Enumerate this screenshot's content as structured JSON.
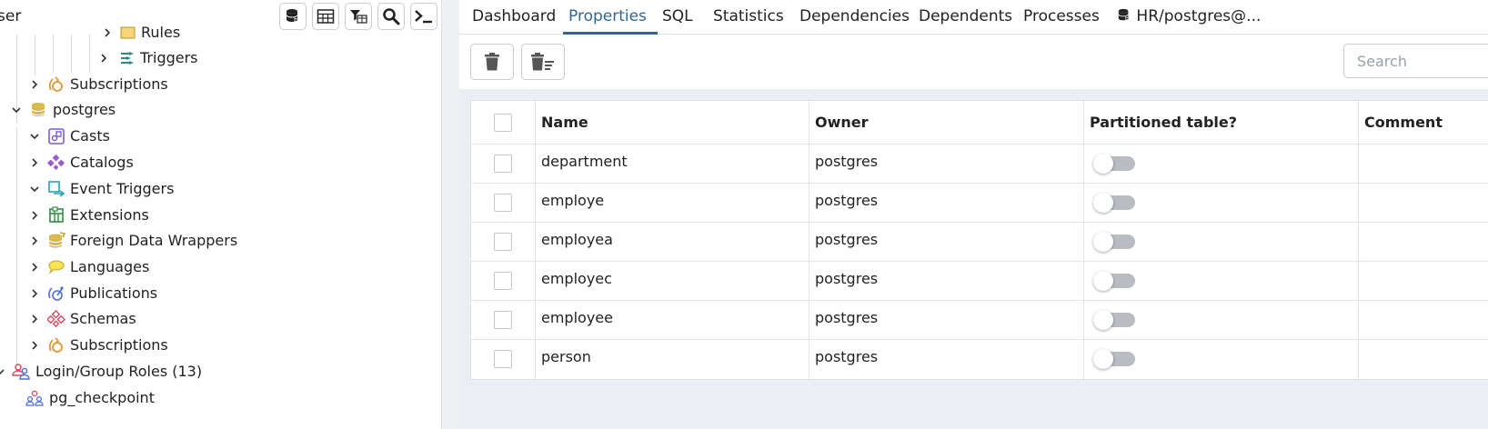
{
  "left_panel": {
    "title": "ser",
    "toolbar_icons": [
      "database-icon",
      "table-icon",
      "filter-icon",
      "search-icon",
      "terminal-icon"
    ],
    "tree": [
      {
        "label": "Rules",
        "chevron": "right",
        "icon": "rules-icon"
      },
      {
        "label": "Triggers",
        "chevron": "right",
        "icon": "triggers-icon"
      },
      {
        "label": "Subscriptions",
        "chevron": "right",
        "icon": "subscriptions-icon"
      },
      {
        "label": "postgres",
        "chevron": "down",
        "icon": "database-icon"
      },
      {
        "label": "Casts",
        "chevron": "down",
        "icon": "casts-icon"
      },
      {
        "label": "Catalogs",
        "chevron": "right",
        "icon": "catalogs-icon"
      },
      {
        "label": "Event Triggers",
        "chevron": "down",
        "icon": "event-triggers-icon"
      },
      {
        "label": "Extensions",
        "chevron": "right",
        "icon": "extensions-icon"
      },
      {
        "label": "Foreign Data Wrappers",
        "chevron": "right",
        "icon": "foreign-data-wrappers-icon"
      },
      {
        "label": "Languages",
        "chevron": "right",
        "icon": "languages-icon"
      },
      {
        "label": "Publications",
        "chevron": "right",
        "icon": "publications-icon"
      },
      {
        "label": "Schemas",
        "chevron": "right",
        "icon": "schemas-icon"
      },
      {
        "label": "Subscriptions",
        "chevron": "right",
        "icon": "subscriptions-icon"
      },
      {
        "label": "Login/Group Roles (13)",
        "chevron": "down",
        "icon": "group-roles-icon"
      },
      {
        "label": "pg_checkpoint",
        "chevron": "",
        "icon": "group-role-icon"
      }
    ]
  },
  "tabs": [
    {
      "label": "Dashboard",
      "active": false
    },
    {
      "label": "Properties",
      "active": true
    },
    {
      "label": "SQL",
      "active": false
    },
    {
      "label": "Statistics",
      "active": false
    },
    {
      "label": "Dependencies",
      "active": false
    },
    {
      "label": "Dependents",
      "active": false
    },
    {
      "label": "Processes",
      "active": false
    },
    {
      "label": "HR/postgres@...",
      "active": false,
      "icon": "database-icon"
    }
  ],
  "toolbar": {
    "delete_icon": "trash-icon",
    "delete_cascade_icon": "trash-cascade-icon",
    "search_placeholder": "Search"
  },
  "grid": {
    "columns": [
      "Name",
      "Owner",
      "Partitioned table?",
      "Comment"
    ],
    "rows": [
      {
        "name": "department",
        "owner": "postgres",
        "partitioned": false,
        "comment": ""
      },
      {
        "name": "employe",
        "owner": "postgres",
        "partitioned": false,
        "comment": ""
      },
      {
        "name": "employea",
        "owner": "postgres",
        "partitioned": false,
        "comment": ""
      },
      {
        "name": "employec",
        "owner": "postgres",
        "partitioned": false,
        "comment": ""
      },
      {
        "name": "employee",
        "owner": "postgres",
        "partitioned": false,
        "comment": ""
      },
      {
        "name": "person",
        "owner": "postgres",
        "partitioned": false,
        "comment": ""
      }
    ]
  },
  "colors": {
    "accent": "#326690",
    "toggle_off": "#b9bcc1",
    "grid_background": "#ebeef3"
  }
}
